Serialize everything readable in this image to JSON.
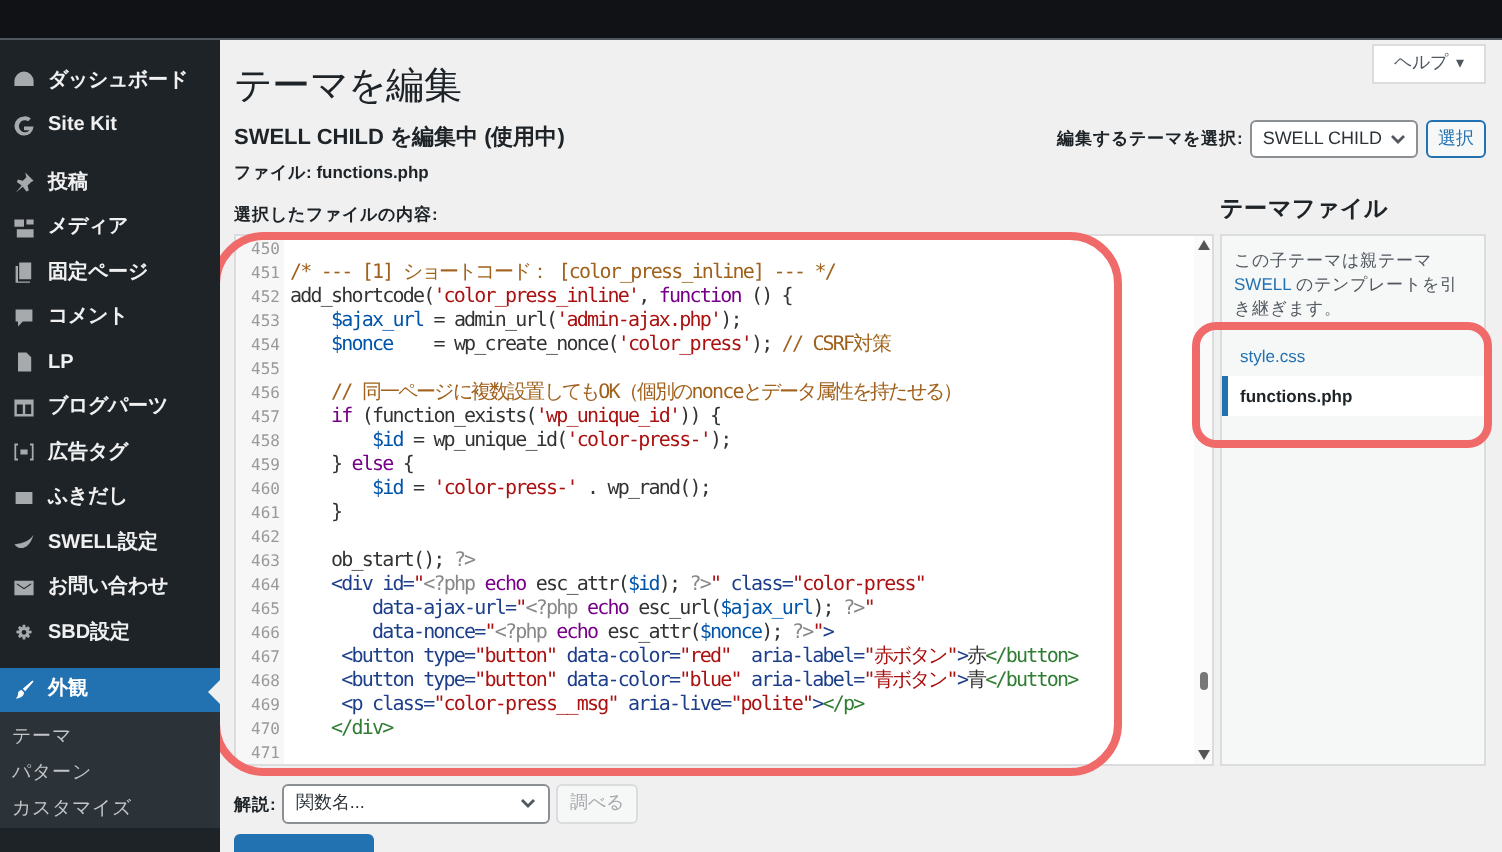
{
  "sidebar": {
    "sections": [
      [
        {
          "label": "ダッシュボード",
          "selected": false
        },
        {
          "label": "Site Kit",
          "selected": false
        }
      ],
      [
        {
          "label": "投稿",
          "selected": false
        },
        {
          "label": "メディア",
          "selected": false
        },
        {
          "label": "固定ページ",
          "selected": false
        },
        {
          "label": "コメント",
          "selected": false
        },
        {
          "label": "LP",
          "selected": false
        },
        {
          "label": "ブログパーツ",
          "selected": false
        },
        {
          "label": "広告タグ",
          "selected": false
        },
        {
          "label": "ふきだし",
          "selected": false
        },
        {
          "label": "SWELL設定",
          "selected": false
        },
        {
          "label": "お問い合わせ",
          "selected": false
        },
        {
          "label": "SBD設定",
          "selected": false
        }
      ],
      [
        {
          "label": "外観",
          "selected": true,
          "children": [
            {
              "label": "テーマ",
              "selected": false
            },
            {
              "label": "パターン",
              "selected": false
            },
            {
              "label": "カスタマイズ",
              "selected": false
            }
          ]
        }
      ]
    ]
  },
  "help_button": {
    "label": "ヘルプ",
    "caret": "▾"
  },
  "title": "テーマを編集",
  "theme_heading": "SWELL CHILD を編集中 (使用中)",
  "file_label": "ファイル: functions.php",
  "content_label": "選択したファイルの内容:",
  "theme_selector": {
    "label": "編集するテーマを選択:",
    "value": "SWELL CHILD",
    "button": "選択"
  },
  "editor": {
    "lines": [
      {
        "number": "450"
      },
      {
        "number": "451",
        "segments": [
          {
            "kind": "comment",
            "text": "/* --- [1] ショートコード： [color_press_inline] --- */"
          }
        ]
      },
      {
        "number": "452",
        "segments": [
          {
            "kind": "plain",
            "text": "add_shortcode("
          },
          {
            "kind": "string",
            "text": "'color_press_inline'"
          },
          {
            "kind": "plain",
            "text": ", "
          },
          {
            "kind": "keyword",
            "text": "function"
          },
          {
            "kind": "plain",
            "text": " () {"
          }
        ]
      },
      {
        "number": "453",
        "segments": [
          {
            "kind": "variable",
            "text": "    $ajax_url"
          },
          {
            "kind": "plain",
            "text": " = admin_url("
          },
          {
            "kind": "string",
            "text": "'admin-ajax.php'"
          },
          {
            "kind": "plain",
            "text": ");"
          }
        ]
      },
      {
        "number": "454",
        "segments": [
          {
            "kind": "variable",
            "text": "    $nonce"
          },
          {
            "kind": "plain",
            "text": "    = wp_create_nonce("
          },
          {
            "kind": "string",
            "text": "'color_press'"
          },
          {
            "kind": "plain",
            "text": "); "
          },
          {
            "kind": "comment",
            "text": "// CSRF対策"
          }
        ]
      },
      {
        "number": "455"
      },
      {
        "number": "456",
        "segments": [
          {
            "kind": "comment",
            "text": "    // 同一ページに複数設置してもOK（個別のnonceとデータ属性を持たせる）"
          }
        ]
      },
      {
        "number": "457",
        "segments": [
          {
            "kind": "keyword",
            "text": "    if"
          },
          {
            "kind": "plain",
            "text": " (function_exists("
          },
          {
            "kind": "string",
            "text": "'wp_unique_id'"
          },
          {
            "kind": "plain",
            "text": ")) {"
          }
        ]
      },
      {
        "number": "458",
        "segments": [
          {
            "kind": "variable",
            "text": "        $id"
          },
          {
            "kind": "plain",
            "text": " = wp_unique_id("
          },
          {
            "kind": "string",
            "text": "'color-press-'"
          },
          {
            "kind": "plain",
            "text": ");"
          }
        ]
      },
      {
        "number": "459",
        "segments": [
          {
            "kind": "plain",
            "text": "    } "
          },
          {
            "kind": "keyword",
            "text": "else"
          },
          {
            "kind": "plain",
            "text": " {"
          }
        ]
      },
      {
        "number": "460",
        "segments": [
          {
            "kind": "variable",
            "text": "        $id"
          },
          {
            "kind": "plain",
            "text": " = "
          },
          {
            "kind": "string",
            "text": "'color-press-'"
          },
          {
            "kind": "plain",
            "text": " . wp_rand();"
          }
        ]
      },
      {
        "number": "461",
        "segments": [
          {
            "kind": "plain",
            "text": "    }"
          }
        ]
      },
      {
        "number": "462"
      },
      {
        "number": "463",
        "segments": [
          {
            "kind": "plain",
            "text": "    ob_start(); "
          },
          {
            "kind": "meta",
            "text": "?>"
          }
        ]
      },
      {
        "number": "464",
        "segments": [
          {
            "kind": "tag",
            "text": "    <div id="
          },
          {
            "kind": "string",
            "text": "\""
          },
          {
            "kind": "meta",
            "text": "<?php"
          },
          {
            "kind": "keyword",
            "text": " echo"
          },
          {
            "kind": "plain",
            "text": " esc_attr("
          },
          {
            "kind": "variable",
            "text": "$id"
          },
          {
            "kind": "plain",
            "text": "); "
          },
          {
            "kind": "meta",
            "text": "?>"
          },
          {
            "kind": "string",
            "text": "\""
          },
          {
            "kind": "tag",
            "text": " class="
          },
          {
            "kind": "string",
            "text": "\"color-press\""
          }
        ]
      },
      {
        "number": "465",
        "segments": [
          {
            "kind": "tag",
            "text": "        data-ajax-url="
          },
          {
            "kind": "string",
            "text": "\""
          },
          {
            "kind": "meta",
            "text": "<?php"
          },
          {
            "kind": "keyword",
            "text": " echo"
          },
          {
            "kind": "plain",
            "text": " esc_url("
          },
          {
            "kind": "variable",
            "text": "$ajax_url"
          },
          {
            "kind": "plain",
            "text": "); "
          },
          {
            "kind": "meta",
            "text": "?>"
          },
          {
            "kind": "string",
            "text": "\""
          }
        ]
      },
      {
        "number": "466",
        "segments": [
          {
            "kind": "tag",
            "text": "        data-nonce="
          },
          {
            "kind": "string",
            "text": "\""
          },
          {
            "kind": "meta",
            "text": "<?php"
          },
          {
            "kind": "keyword",
            "text": " echo"
          },
          {
            "kind": "plain",
            "text": " esc_attr("
          },
          {
            "kind": "variable",
            "text": "$nonce"
          },
          {
            "kind": "plain",
            "text": "); "
          },
          {
            "kind": "meta",
            "text": "?>"
          },
          {
            "kind": "string",
            "text": "\""
          },
          {
            "kind": "tag",
            "text": ">"
          }
        ]
      },
      {
        "number": "467",
        "segments": [
          {
            "kind": "tag",
            "text": "     <button type="
          },
          {
            "kind": "string",
            "text": "\"button\""
          },
          {
            "kind": "tag",
            "text": " data-color="
          },
          {
            "kind": "string",
            "text": "\"red\""
          },
          {
            "kind": "tag",
            "text": "  aria-label="
          },
          {
            "kind": "string",
            "text": "\"赤ボタン\""
          },
          {
            "kind": "tag",
            "text": ">"
          },
          {
            "kind": "plain",
            "text": "赤"
          },
          {
            "kind": "closetag",
            "text": "</button>"
          }
        ]
      },
      {
        "number": "468",
        "segments": [
          {
            "kind": "tag",
            "text": "     <button type="
          },
          {
            "kind": "string",
            "text": "\"button\""
          },
          {
            "kind": "tag",
            "text": " data-color="
          },
          {
            "kind": "string",
            "text": "\"blue\""
          },
          {
            "kind": "tag",
            "text": " aria-label="
          },
          {
            "kind": "string",
            "text": "\"青ボタン\""
          },
          {
            "kind": "tag",
            "text": ">"
          },
          {
            "kind": "plain",
            "text": "青"
          },
          {
            "kind": "closetag",
            "text": "</button>"
          }
        ]
      },
      {
        "number": "469",
        "segments": [
          {
            "kind": "tag",
            "text": "     <p class="
          },
          {
            "kind": "string",
            "text": "\"color-press__msg\""
          },
          {
            "kind": "tag",
            "text": " aria-live="
          },
          {
            "kind": "string",
            "text": "\"polite\""
          },
          {
            "kind": "tag",
            "text": ">"
          },
          {
            "kind": "closetag",
            "text": "</p>"
          }
        ]
      },
      {
        "number": "470",
        "segments": [
          {
            "kind": "closetag",
            "text": "    </div>"
          }
        ]
      },
      {
        "number": "471"
      }
    ]
  },
  "theme_files": {
    "title": "テーマファイル",
    "notice": {
      "before": "この子テーマは親テーマ ",
      "link": "SWELL",
      "after": " のテンプレートを引き継ぎます。"
    },
    "files": [
      {
        "name": "style.css",
        "selected": false
      },
      {
        "name": "functions.php",
        "selected": true
      }
    ]
  },
  "documentation": {
    "label": "解説:",
    "value": "関数名...",
    "button": "調べる",
    "disabled": true
  }
}
